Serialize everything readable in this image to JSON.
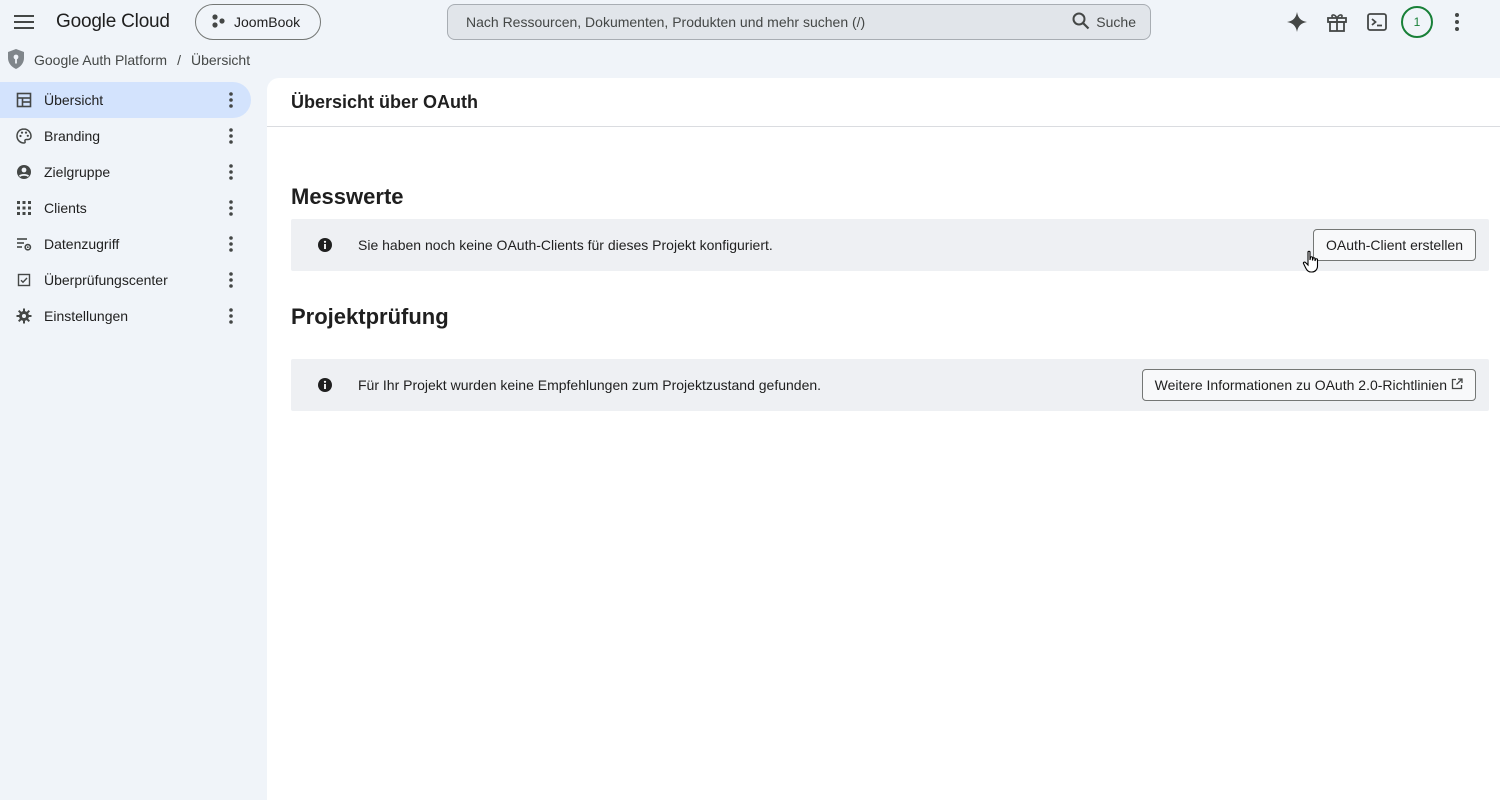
{
  "header": {
    "logo_text": "Google Cloud",
    "project_name": "JoomBook",
    "search_placeholder": "Nach Ressourcen, Dokumenten, Produkten und mehr suchen (/)",
    "search_button_label": "Suche",
    "notification_count": "1"
  },
  "breadcrumb": {
    "product": "Google Auth Platform",
    "separator": "/",
    "current": "Übersicht"
  },
  "sidebar": {
    "items": [
      {
        "label": "Übersicht",
        "icon": "dashboard-icon",
        "active": true
      },
      {
        "label": "Branding",
        "icon": "palette-icon",
        "active": false
      },
      {
        "label": "Zielgruppe",
        "icon": "account-circle-icon",
        "active": false
      },
      {
        "label": "Clients",
        "icon": "apps-grid-icon",
        "active": false
      },
      {
        "label": "Datenzugriff",
        "icon": "data-settings-icon",
        "active": false
      },
      {
        "label": "Überprüfungscenter",
        "icon": "checkbox-icon",
        "active": false
      },
      {
        "label": "Einstellungen",
        "icon": "gear-icon",
        "active": false
      }
    ]
  },
  "main": {
    "title": "Übersicht über OAuth",
    "metrics": {
      "heading": "Messwerte",
      "message": "Sie haben noch keine OAuth-Clients für dieses Projekt konfiguriert.",
      "button_label": "OAuth-Client erstellen"
    },
    "project_check": {
      "heading": "Projektprüfung",
      "message": "Für Ihr Projekt wurden keine Empfehlungen zum Projektzustand gefunden.",
      "button_label": "Weitere Informationen zu OAuth 2.0-Richtlinien"
    }
  },
  "colors": {
    "background": "#f0f4f9",
    "active_nav": "#d3e3fd",
    "info_bar": "#eef0f3",
    "badge_green": "#188038"
  }
}
